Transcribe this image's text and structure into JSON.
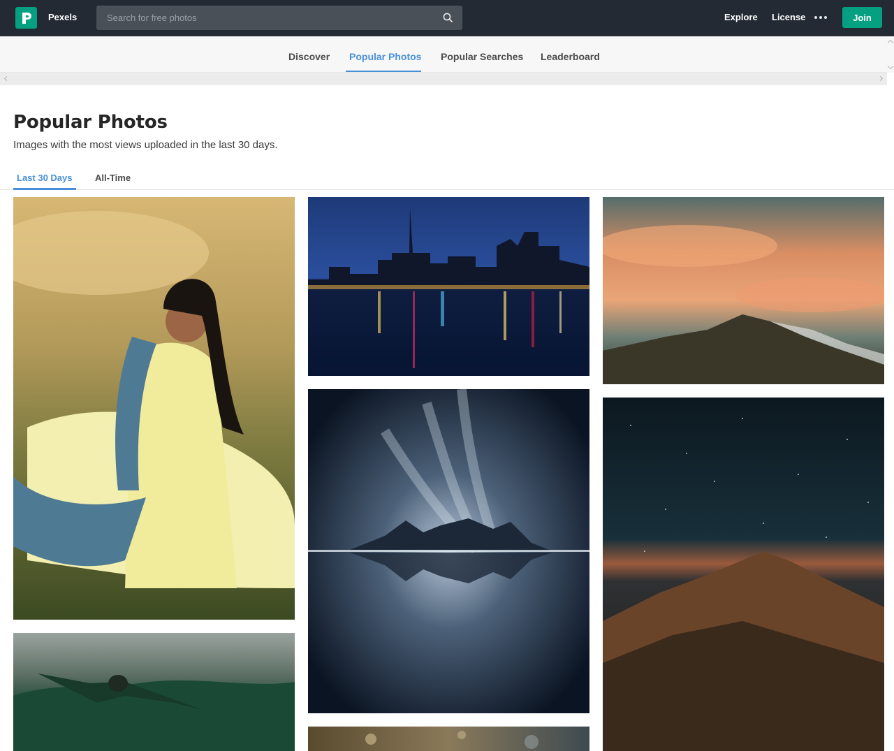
{
  "header": {
    "brand": "Pexels",
    "search_placeholder": "Search for free photos",
    "nav": {
      "explore": "Explore",
      "license": "License"
    },
    "join_label": "Join",
    "colors": {
      "bar": "#232a34",
      "accent": "#05a081"
    }
  },
  "subnav": {
    "items": [
      {
        "label": "Discover"
      },
      {
        "label": "Popular Photos",
        "active": true
      },
      {
        "label": "Popular Searches"
      },
      {
        "label": "Leaderboard"
      }
    ],
    "active_color": "#4a90d9"
  },
  "page": {
    "title": "Popular Photos",
    "subtitle": "Images with the most views uploaded in the last 30 days.",
    "tabs": [
      {
        "label": "Last 30 Days",
        "active": true
      },
      {
        "label": "All-Time"
      }
    ]
  },
  "photos": [
    {
      "subject": "woman-in-yellow-dress"
    },
    {
      "subject": "city-skyline-at-night"
    },
    {
      "subject": "sunset-mountain-clouds"
    },
    {
      "subject": "aurora-mountain-reflection"
    },
    {
      "subject": "starry-sky-mountain"
    },
    {
      "subject": "person-arms-outstretched-forest"
    },
    {
      "subject": "bokeh-photo"
    }
  ]
}
